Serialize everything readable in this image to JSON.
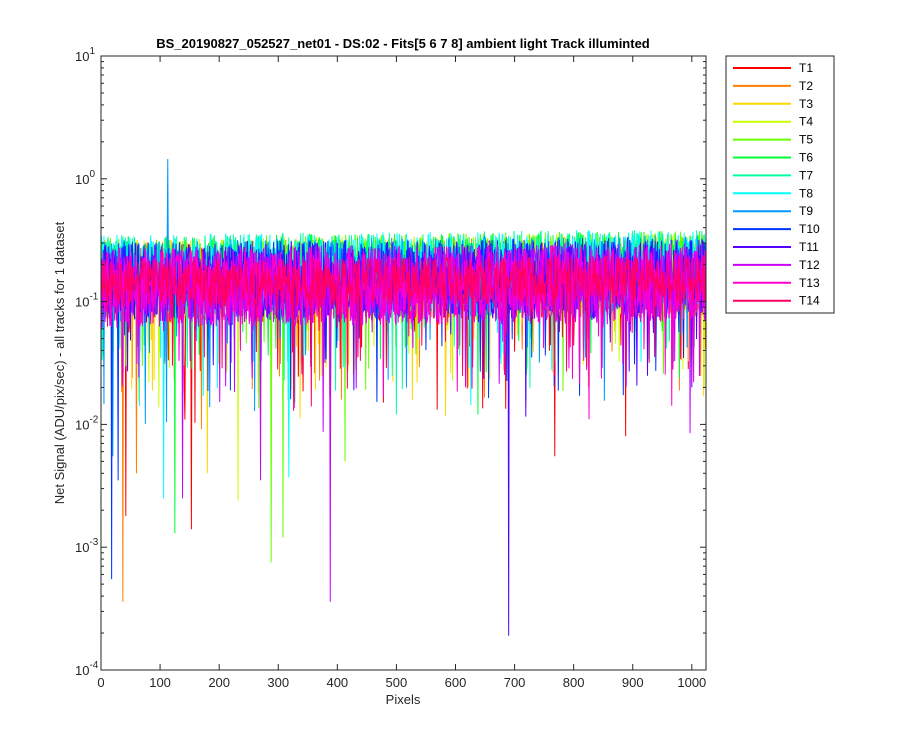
{
  "chart_data": {
    "type": "line",
    "title": "BS_20190827_052527_net01 - DS:02 - Fits[5  6  7  8]   ambient light   Track illuminted",
    "xlabel": "Pixels",
    "ylabel": "Net Signal (ADU/pix/sec) - all tracks for 1 dataset",
    "xlim": [
      0,
      1024
    ],
    "ylim": [
      0.0001,
      10
    ],
    "yscale": "log",
    "xticks": [
      "0",
      "100",
      "200",
      "300",
      "400",
      "500",
      "600",
      "700",
      "800",
      "900",
      "1000"
    ],
    "yticks": [
      {
        "base": "10",
        "exp": "-4"
      },
      {
        "base": "10",
        "exp": "-3"
      },
      {
        "base": "10",
        "exp": "-2"
      },
      {
        "base": "10",
        "exp": "-1"
      },
      {
        "base": "10",
        "exp": "0"
      },
      {
        "base": "10",
        "exp": "1"
      }
    ],
    "grid": false,
    "legend_position": "outside-right",
    "series": [
      {
        "name": "T1",
        "color": "#ff0000",
        "baseline": 0.14,
        "trend": 0.1,
        "amplitude": 0.75,
        "dips": [
          [
            42,
            0.0018
          ],
          [
            153,
            0.0014
          ],
          [
            768,
            0.0055
          ],
          [
            888,
            0.008
          ]
        ]
      },
      {
        "name": "T2",
        "color": "#ff7f00",
        "baseline": 0.145,
        "trend": 0.1,
        "amplitude": 0.75,
        "dips": [
          [
            37,
            0.00036
          ],
          [
            60,
            0.004
          ]
        ]
      },
      {
        "name": "T3",
        "color": "#ffd700",
        "baseline": 0.15,
        "trend": 0.1,
        "amplitude": 0.75,
        "dips": [
          [
            180,
            0.004
          ]
        ]
      },
      {
        "name": "T4",
        "color": "#c8ff00",
        "baseline": 0.155,
        "trend": 0.1,
        "amplitude": 0.75,
        "dips": [
          [
            232,
            0.0024
          ]
        ]
      },
      {
        "name": "T5",
        "color": "#66ff00",
        "baseline": 0.16,
        "trend": 0.12,
        "amplitude": 0.75,
        "dips": [
          [
            288,
            0.00075
          ],
          [
            308,
            0.0012
          ],
          [
            413,
            0.005
          ]
        ]
      },
      {
        "name": "T6",
        "color": "#00ff33",
        "baseline": 0.16,
        "trend": 0.12,
        "amplitude": 0.75,
        "dips": [
          [
            125,
            0.0013
          ],
          [
            638,
            0.012
          ]
        ]
      },
      {
        "name": "T7",
        "color": "#00ffa0",
        "baseline": 0.165,
        "trend": 0.12,
        "amplitude": 0.75,
        "dips": [
          [
            500,
            0.012
          ]
        ]
      },
      {
        "name": "T8",
        "color": "#00ffff",
        "baseline": 0.165,
        "trend": 0.12,
        "amplitude": 0.75,
        "dips": [
          [
            106,
            0.0025
          ],
          [
            318,
            0.0037
          ]
        ]
      },
      {
        "name": "T9",
        "color": "#0099ff",
        "baseline": 0.15,
        "trend": 0.1,
        "amplitude": 0.75,
        "dips": [
          [
            20,
            0.0055
          ]
        ],
        "spikes": [
          [
            113,
            1.45
          ]
        ]
      },
      {
        "name": "T10",
        "color": "#0033ff",
        "baseline": 0.145,
        "trend": 0.1,
        "amplitude": 0.75,
        "dips": [
          [
            18,
            0.00055
          ],
          [
            29,
            0.0035
          ]
        ]
      },
      {
        "name": "T11",
        "color": "#5500ff",
        "baseline": 0.14,
        "trend": 0.1,
        "amplitude": 0.75,
        "dips": [
          [
            690,
            0.00019
          ],
          [
            1000,
            0.02
          ]
        ]
      },
      {
        "name": "T12",
        "color": "#cc00ff",
        "baseline": 0.13,
        "trend": 0.1,
        "amplitude": 0.75,
        "dips": [
          [
            388,
            0.00036
          ],
          [
            138,
            0.0025
          ],
          [
            270,
            0.0035
          ],
          [
            997,
            0.0085
          ]
        ]
      },
      {
        "name": "T13",
        "color": "#ff00cc",
        "baseline": 0.13,
        "trend": 0.1,
        "amplitude": 0.75,
        "dips": []
      },
      {
        "name": "T14",
        "color": "#ff0066",
        "baseline": 0.14,
        "trend": 0.1,
        "amplitude": 0.45,
        "dips": []
      }
    ]
  }
}
